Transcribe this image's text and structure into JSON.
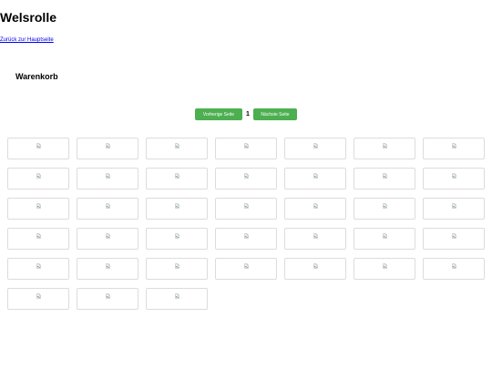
{
  "site": {
    "title": "Welsrolle"
  },
  "nav": {
    "back_label": "Zurück zur Hauptseite"
  },
  "cart": {
    "heading": "Warenkorb"
  },
  "pagination": {
    "prev_label": "Vorherige Seite",
    "current_page": "1",
    "next_label": "Nächste Seite"
  },
  "colors": {
    "button_bg": "#4caf50",
    "tile_border": "#dcdcdc",
    "link": "#0000ee"
  },
  "products": {
    "item_count": 38,
    "image_state": "broken-image-icon"
  }
}
